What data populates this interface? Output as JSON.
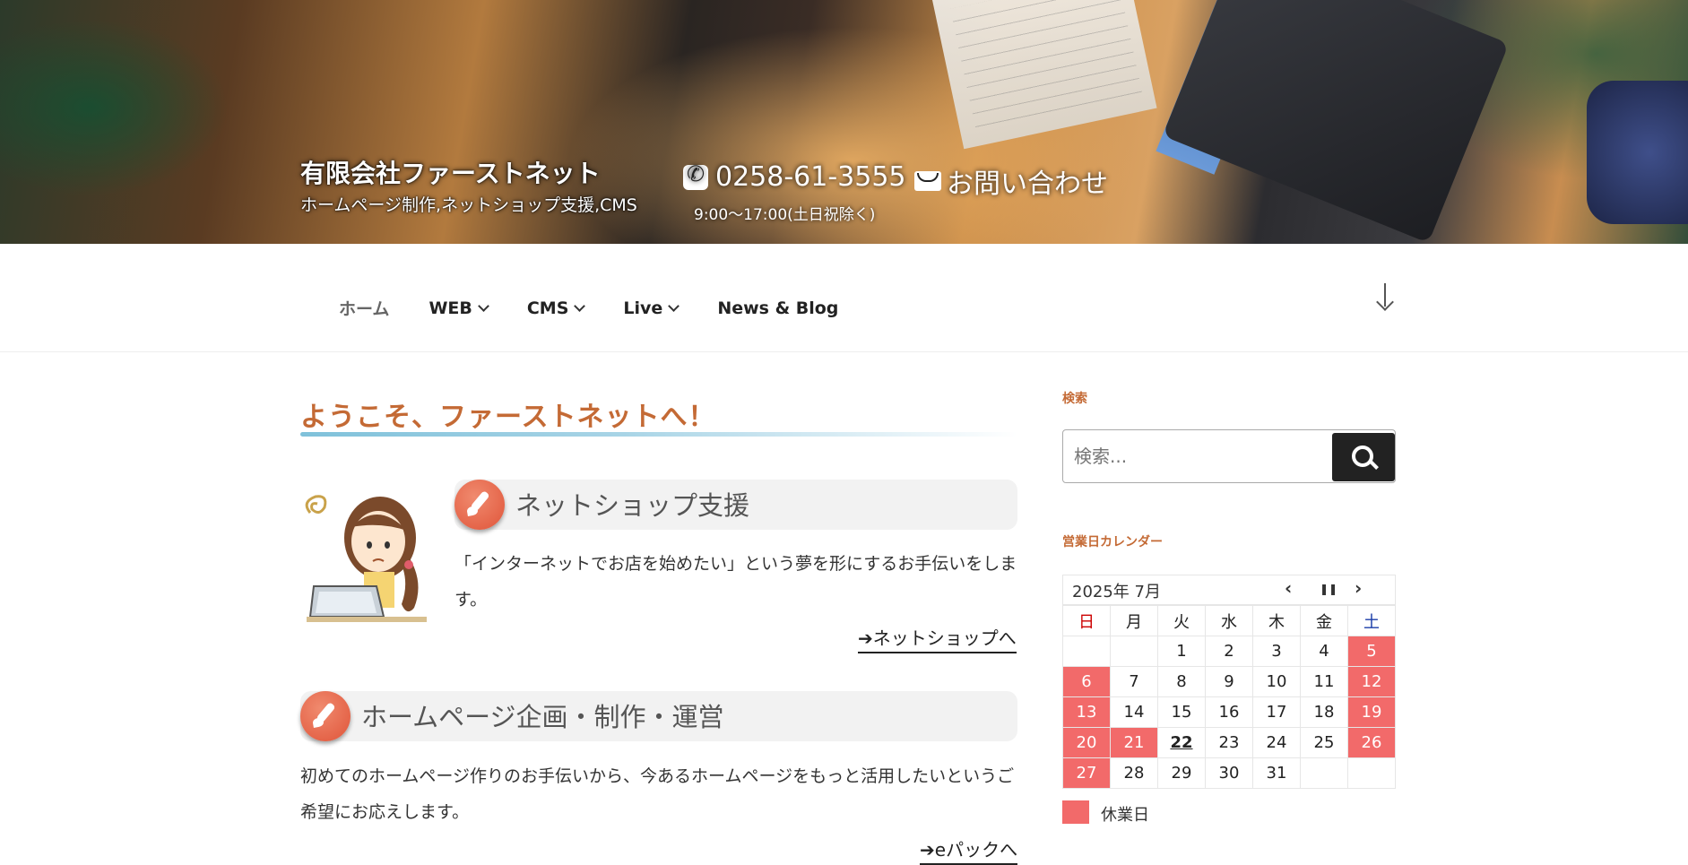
{
  "header": {
    "site_title": "有限会社ファーストネット",
    "site_description": "ホームページ制作,ネットショップ支援,CMS",
    "phone": "0258-61-3555",
    "contact_label": "お問い合わせ",
    "hours": "9:00～17:00(土日祝除く)"
  },
  "nav": {
    "items": [
      {
        "label": "ホーム",
        "has_dropdown": false
      },
      {
        "label": "WEB",
        "has_dropdown": true
      },
      {
        "label": "CMS",
        "has_dropdown": true
      },
      {
        "label": "Live",
        "has_dropdown": true
      },
      {
        "label": "News & Blog",
        "has_dropdown": false
      }
    ]
  },
  "main": {
    "heading": "ようこそ、ファーストネットへ！",
    "sections": [
      {
        "title": "ネットショップ支援",
        "text": "「インターネットでお店を始めたい」という夢を形にするお手伝いをします。",
        "link": "ネットショップへ"
      },
      {
        "title": "ホームページ企画・制作・運営",
        "text": "初めてのホームページ作りのお手伝いから、今あるホームページをもっと活用したいというご希望にお応えします。",
        "link": "eパックへ"
      }
    ]
  },
  "sidebar": {
    "search_label": "検索",
    "search_placeholder": "検索...",
    "calendar_label": "営業日カレンダー",
    "calendar": {
      "month": "2025年 7月",
      "prev": "‹",
      "pause": "❚❚",
      "next": "›",
      "weekdays": [
        "日",
        "月",
        "火",
        "水",
        "木",
        "金",
        "土"
      ],
      "weeks": [
        [
          "",
          "",
          "1",
          "2",
          "3",
          "4",
          "5"
        ],
        [
          "6",
          "7",
          "8",
          "9",
          "10",
          "11",
          "12"
        ],
        [
          "13",
          "14",
          "15",
          "16",
          "17",
          "18",
          "19"
        ],
        [
          "20",
          "21",
          "22",
          "23",
          "24",
          "25",
          "26"
        ],
        [
          "27",
          "28",
          "29",
          "30",
          "31",
          "",
          ""
        ]
      ],
      "holidays": [
        "5",
        "6",
        "12",
        "13",
        "19",
        "20",
        "21",
        "26",
        "27"
      ],
      "today": "22",
      "legend": "休業日",
      "holiday_color": "#f26a6a"
    }
  },
  "colors": {
    "accent": "#c46a35",
    "icon_circle": "#e65c40"
  }
}
